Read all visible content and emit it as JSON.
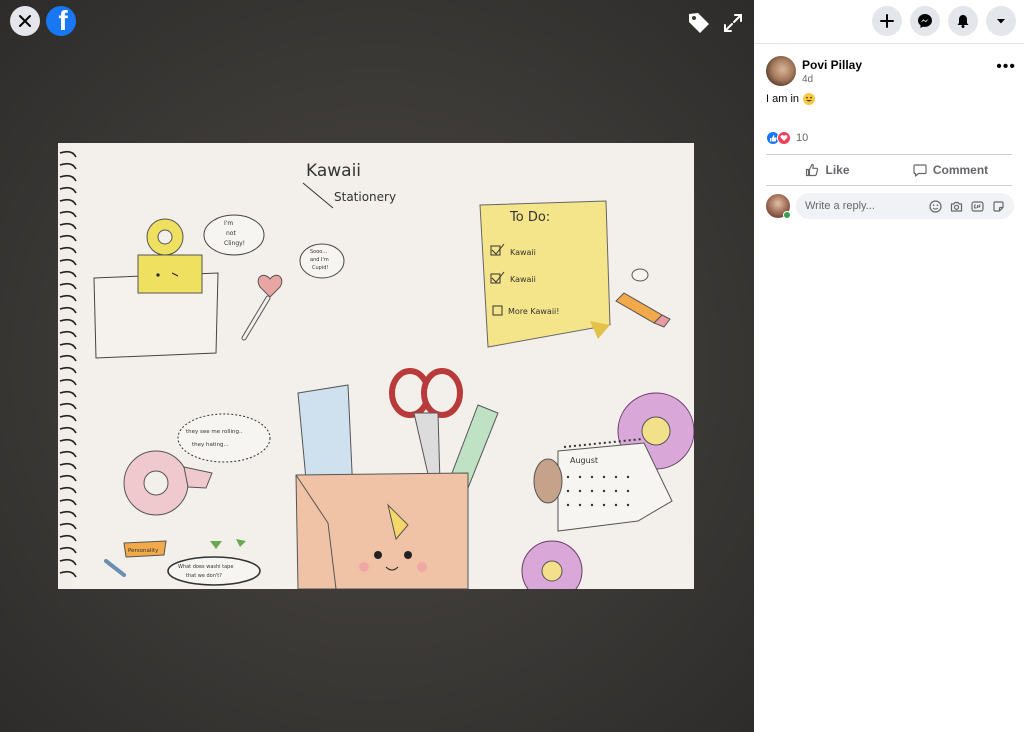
{
  "viewer": {
    "photo": {
      "title_line1": "Kawaii",
      "title_line2": "Stationery",
      "todo_title": "To Do:",
      "todo_items": [
        "Kawaii",
        "Kawaii",
        "More Kawaii!"
      ],
      "clip_bubble": [
        "I'm",
        "not",
        "Clingy!"
      ],
      "heart_bubble": [
        "Sooo...",
        "and I'm",
        "Cupid!"
      ],
      "tape_bubble": [
        "they see me rolling..",
        "they hating..."
      ],
      "calendar_month": "August",
      "personality_label": "Personality",
      "bottom_bubble": [
        "What does washi tape",
        "that we don't?"
      ]
    }
  },
  "sidebar": {
    "post": {
      "author": "Povi Pillay",
      "time": "4d",
      "text": "I am in",
      "reaction_count": "10"
    },
    "actions": {
      "like_label": "Like",
      "comment_label": "Comment"
    },
    "reply": {
      "placeholder": "Write a reply..."
    }
  },
  "colors": {
    "facebook_blue": "#1877f2",
    "love_red": "#f33e58",
    "online_green": "#31a24c"
  }
}
